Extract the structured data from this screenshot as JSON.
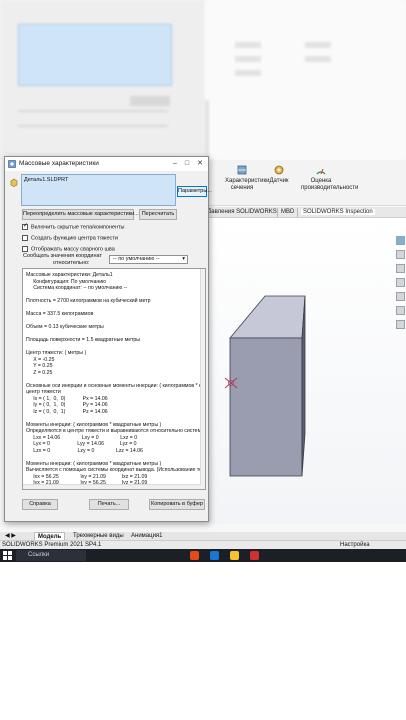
{
  "dialog": {
    "title": "Массовые характеристики",
    "selection": "Деталь1.SLDPRT",
    "options_button": "Параметры...",
    "override_button": "Переопределить массовые характеристики...",
    "recalc_button": "Пересчитать",
    "checkboxes": [
      {
        "label": "Включить скрытые тела/компоненты",
        "checked": true
      },
      {
        "label": "Создать функцию центра тяжести",
        "checked": false
      },
      {
        "label": "Отображать массу сварного шва",
        "checked": false
      }
    ],
    "coord_label_1": "Сообщать значения координат",
    "coord_label_2": "относительно:",
    "coord_value": "-- по умолчанию --",
    "results_lines": [
      "Массовые характеристики: Деталь1",
      "     Конфигурация: По умолчанию",
      "     Система координат: -- по умолчанию --",
      "",
      "Плотность = 2700 килограммов на кубический метр",
      "",
      "Масса = 337.5 килограммов",
      "",
      "Объем = 0.13 кубические метры",
      "",
      "Площадь поверхности = 1.5 квадратные метры",
      "",
      "Центр тяжести: ( метры )",
      "     X = -0.25",
      "     Y = 0.25",
      "     Z = 0.25",
      "",
      "Основные оси инерции и основные моменты инерции: ( килограммов * квадрат",
      "центр тяжести",
      "     Ix = ( 1,  0,  0)            Px = 14.06",
      "     Iy = ( 0,  1,  0)            Py = 14.06",
      "     Iz = ( 0,  0,  1)            Pz = 14.06",
      "",
      "Моменты инерции: ( килограммов * квадратные метры )",
      "Определяются в центре тяжести и выравниваются относительно системы коор",
      "     Lxx = 14.06               Lxy = 0               Lxz = 0",
      "     Lyx = 0                   Lyy = 14.06           Lyz = 0",
      "     Lzx = 0                   Lzy = 0               Lzz = 14.06",
      "",
      "Моменты инерции: ( килограммов * квадратные метры )",
      "Вычисляется с помощью системы координат вывода. (Использование тензор",
      "     Ixx = 56.25               Ixy = 21.09           Ixz = 21.09",
      "     Iyx = 21.09               Iyy = 56.25           Iyz = 21.09",
      "     Izx = 21.09               Izy = 21.09           Izz = 56.25"
    ],
    "help_button": "Справка",
    "print_button": "Печать...",
    "copy_button": "Копировать в буфер"
  },
  "commandbar": {
    "items": [
      "Характеристики сечения",
      "Датчик",
      "Оценка производительности"
    ]
  },
  "tabs": [
    "бавления SOLIDWORKS",
    "MBD",
    "SOLIDWORKS Inspection"
  ],
  "bottom_tabs": [
    "Модель",
    "Трехмерные виды",
    "Анимация1"
  ],
  "status": {
    "left": "SOLIDWORKS Premium 2021 SP4.1",
    "right": "Настройка"
  },
  "taskbar": {
    "search_placeholder": "Ссылки"
  },
  "colors": {
    "cube_top": "#c6c8d8",
    "cube_front": "#9a9cb0",
    "cube_side": "#5c5e70",
    "selection": "#cfe4f7",
    "taskbar": "#1b1f26"
  }
}
